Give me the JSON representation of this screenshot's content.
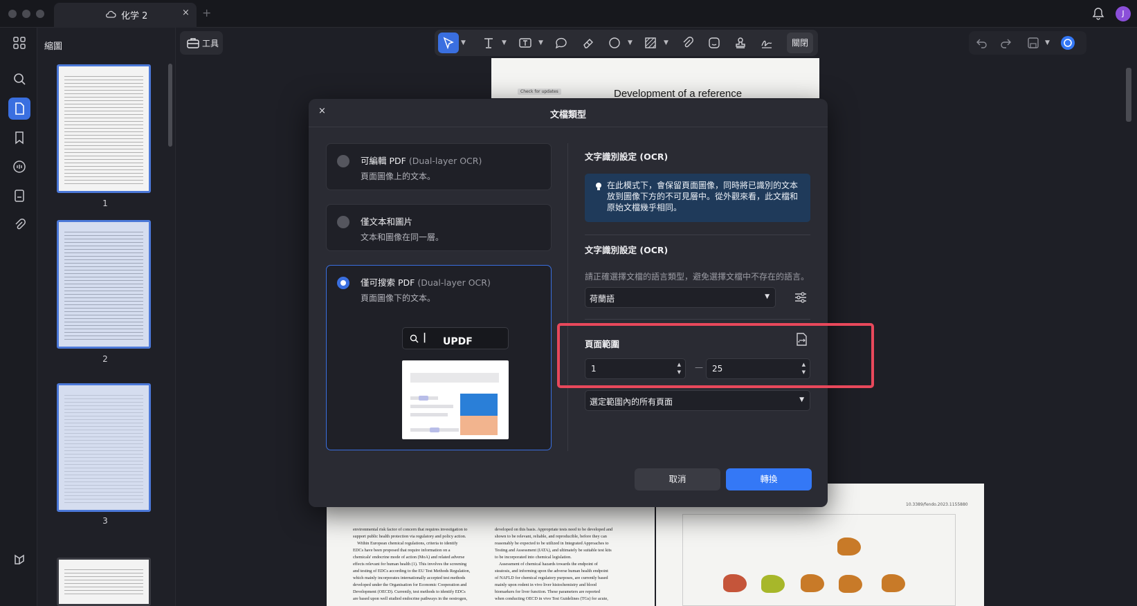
{
  "titlebar": {
    "tab_title": "化学 2",
    "close_tab": "×",
    "new_tab": "+",
    "avatar_initial": "J"
  },
  "thumbnails": {
    "title": "縮圖",
    "pages": [
      "1",
      "2",
      "3"
    ]
  },
  "toolbar": {
    "tools_label": "工具",
    "close_label": "關閉"
  },
  "document": {
    "heading": "Development of a reference",
    "check_updates": "Check for updates",
    "doi": "10.3389/fendo.2023.1155880",
    "col1": "environmental risk factor of concern that requires investigation to\nsupport public health protection via regulatory and policy action.\n    Within European chemical regulations, criteria to identify\nEDCs have been proposed that require information on a\nchemicals' endocrine mode of action (MoA) and related adverse\neffects relevant for human health (1). This involves the screening\nand testing of EDCs according to the EU Test Methods Regulation,\nwhich mainly incorporates internationally accepted test methods\ndeveloped under the Organisation for Economic Cooperation and\nDevelopment (OECD). Currently, test methods to identify EDCs\nare based upon well studied endocrine pathways in the oestrogen,",
    "col2": "developed on this basis. Appropriate tests need to be developed and\nshown to be relevant, reliable, and reproducible, before they can\nreasonably be expected to be utilized in Integrated Approaches to\nTesting and Assessment (IATA), and ultimately be suitable test kits\nto be incorporated into chemical legislation.\n    Assessment of chemical hazards towards the endpoint of\nsteatosis, and informing upon the adverse human health endpoint\nof NAFLD for chemical regulatory purposes, are currently based\nmainly upon rodent in vivo liver histochemistry and blood\nbiomarkers for liver function. These parameters are reported\nwhen conducting OECD in vivo Test Guidelines (TGs) for acute,"
  },
  "dialog": {
    "close": "×",
    "title": "文檔類型",
    "options": [
      {
        "title": "可編輯 PDF",
        "title_en": "(Dual-layer OCR)",
        "desc": "頁面圖像上的文本。",
        "selected": false
      },
      {
        "title": "僅文本和圖片",
        "title_en": "",
        "desc": "文本和圖像在同一層。",
        "selected": false
      },
      {
        "title": "僅可搜索 PDF",
        "title_en": "(Dual-layer OCR)",
        "desc": "頁面圖像下的文本。",
        "selected": true
      }
    ],
    "demo_search_text": "UPDF",
    "ocr_section_title": "文字識別設定 (OCR)",
    "info_text": "在此模式下，會保留頁面圖像，同時將已識別的文本放到圖像下方的不可見層中。從外觀來看，此文檔和原始文檔幾乎相同。",
    "lang_section_title": "文字識別設定 (OCR)",
    "lang_hint": "請正確選擇文檔的語言類型，避免選擇文檔中不存在的語言。",
    "language_value": "荷蘭語",
    "range_title": "頁面範圍",
    "range_from": "1",
    "range_to": "25",
    "range_dash": "—",
    "range_mode": "選定範圍內的所有頁面",
    "cancel_label": "取消",
    "convert_label": "轉換"
  },
  "colors": {
    "accent": "#3478f6",
    "highlight": "#e8485b",
    "info_bg": "#1f3a5a"
  }
}
